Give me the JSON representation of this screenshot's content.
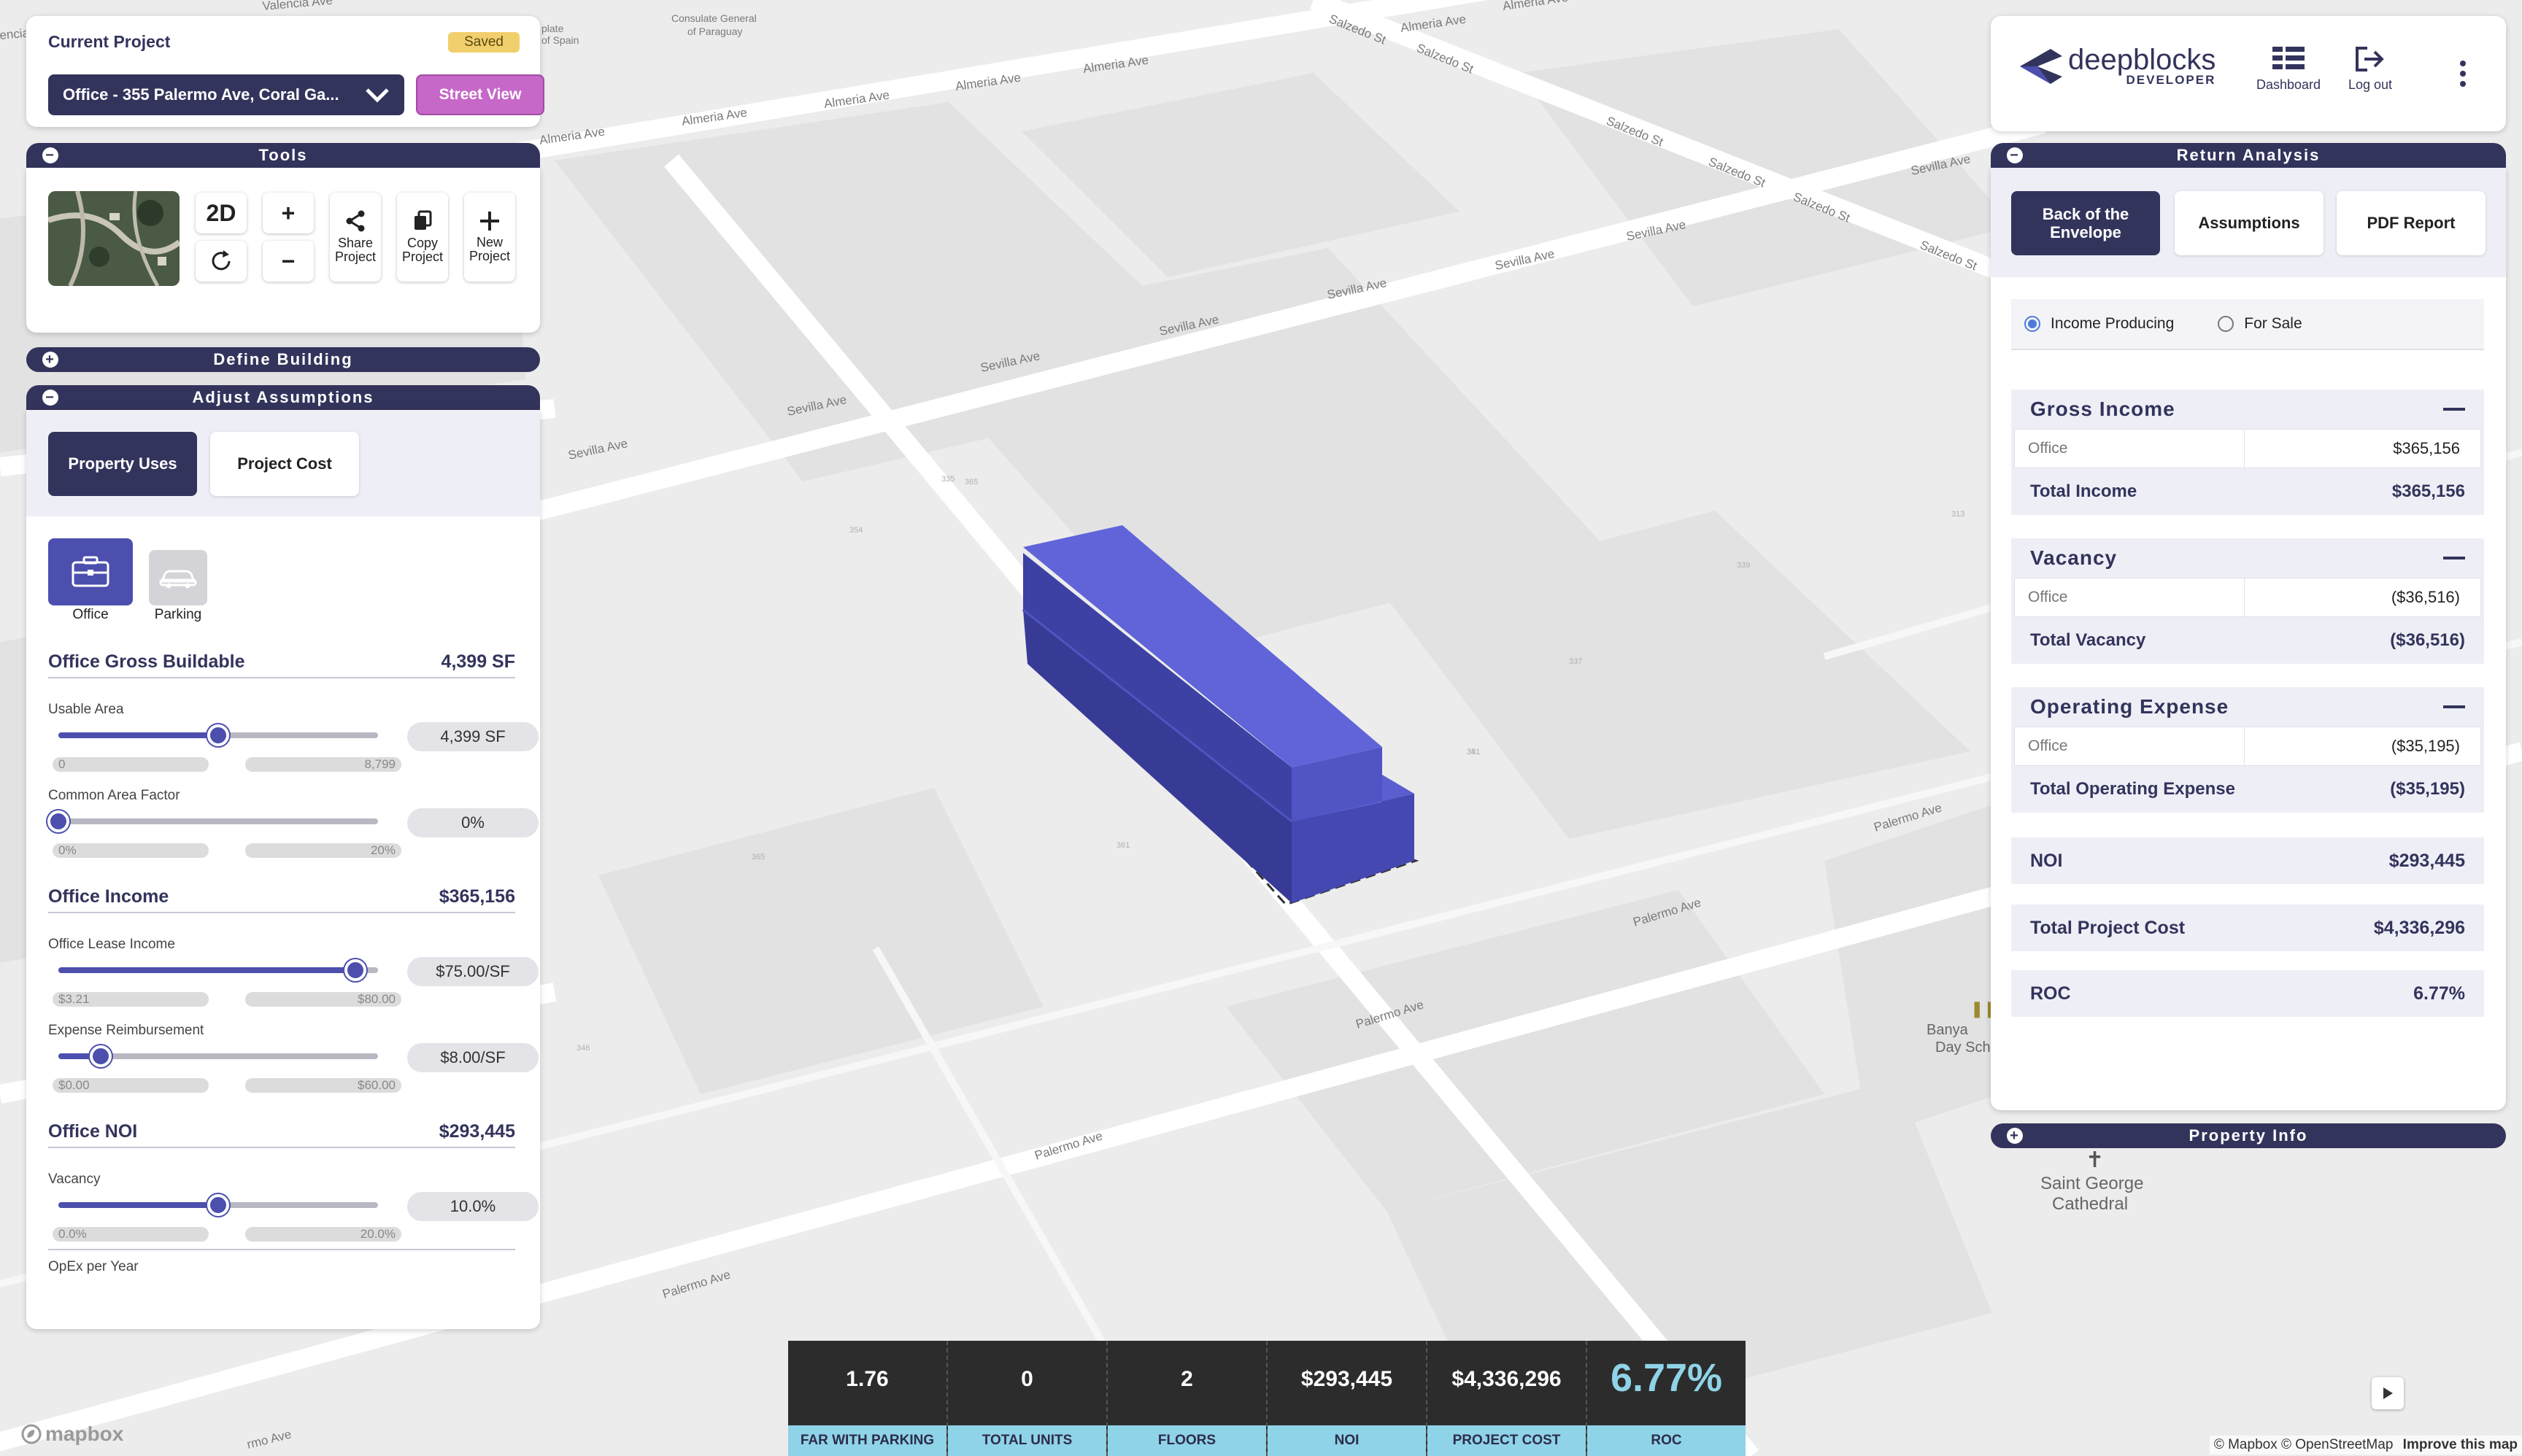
{
  "project": {
    "title": "Current Project",
    "status": "Saved",
    "selected": "Office - 355 Palermo Ave, Coral Ga...",
    "street_view": "Street View"
  },
  "tools": {
    "title": "Tools",
    "mode": "2D",
    "zoom_in": "+",
    "zoom_out": "−",
    "share": "Share Project",
    "copy": "Copy Project",
    "new": "New Project"
  },
  "define_building": {
    "title": "Define Building"
  },
  "assumptions": {
    "title": "Adjust Assumptions",
    "tabs": [
      "Property Uses",
      "Project Cost"
    ],
    "uses": [
      {
        "label": "Office",
        "icon": "briefcase-icon",
        "active": true
      },
      {
        "label": "Parking",
        "icon": "car-icon",
        "active": false
      }
    ],
    "sections": [
      {
        "title": "Office Gross Buildable",
        "value": "4,399 SF",
        "sliders": [
          {
            "label": "Usable Area",
            "min": "0",
            "max": "8,799",
            "value": "4,399 SF",
            "pct": 0.5
          },
          {
            "label": "Common Area Factor",
            "min": "0%",
            "max": "20%",
            "value": "0%",
            "pct": 0.0
          }
        ]
      },
      {
        "title": "Office Income",
        "value": "$365,156",
        "sliders": [
          {
            "label": "Office Lease Income",
            "min": "$3.21",
            "max": "$80.00",
            "value": "$75.00/SF",
            "pct": 0.93
          },
          {
            "label": "Expense Reimbursement",
            "min": "$0.00",
            "max": "$60.00",
            "value": "$8.00/SF",
            "pct": 0.133
          }
        ]
      },
      {
        "title": "Office NOI",
        "value": "$293,445",
        "sliders": [
          {
            "label": "Vacancy",
            "min": "0.0%",
            "max": "20.0%",
            "value": "10.0%",
            "pct": 0.5
          },
          {
            "label": "OpEx per Year"
          }
        ]
      }
    ]
  },
  "header": {
    "logo_word": "deepblocks",
    "logo_sub": "DEVELOPER",
    "dashboard": "Dashboard",
    "logout": "Log out"
  },
  "return_analysis": {
    "title": "Return Analysis",
    "tabs": [
      "Back of the Envelope",
      "Assumptions",
      "PDF Report"
    ],
    "radio": [
      "Income Producing",
      "For Sale"
    ],
    "gross_income": {
      "title": "Gross Income",
      "line_label": "Office",
      "line_value": "$365,156",
      "total_label": "Total Income",
      "total_value": "$365,156"
    },
    "vacancy": {
      "title": "Vacancy",
      "line_label": "Office",
      "line_value": "($36,516)",
      "total_label": "Total Vacancy",
      "total_value": "($36,516)"
    },
    "opex": {
      "title": "Operating Expense",
      "line_label": "Office",
      "line_value": "($35,195)",
      "total_label": "Total Operating Expense",
      "total_value": "($35,195)"
    },
    "noi": {
      "label": "NOI",
      "value": "$293,445"
    },
    "project_cost": {
      "label": "Total Project Cost",
      "value": "$4,336,296"
    },
    "roc": {
      "label": "ROC",
      "value": "6.77%"
    }
  },
  "property_info": {
    "title": "Property Info"
  },
  "stats": [
    {
      "value": "1.76",
      "label": "FAR WITH PARKING"
    },
    {
      "value": "0",
      "label": "TOTAL UNITS"
    },
    {
      "value": "2",
      "label": "FLOORS"
    },
    {
      "value": "$293,445",
      "label": "NOI"
    },
    {
      "value": "$4,336,296",
      "label": "PROJECT COST"
    },
    {
      "value": "6.77%",
      "label": "ROC"
    }
  ],
  "map": {
    "streets": {
      "palermo": "Palermo Ave",
      "sevilla": "Sevilla Ave",
      "almeria": "Almeria Ave",
      "salzedo": "Salzedo St",
      "valencia": "Valencia Ave",
      "encia": "encia",
      "rmo": "rmo Ave"
    },
    "pois": {
      "consulate_paraguay_1": "Consulate General",
      "consulate_paraguay_2": "of Paraguay",
      "consulate_spain_1": "plate",
      "consulate_spain_2": "of Spain",
      "banyan_1": "Banya",
      "banyan_2": "Day Sch",
      "cathedral_1": "Saint George",
      "cathedral_2": "Cathedral"
    },
    "lot_numbers": [
      "365",
      "361",
      "335",
      "337",
      "339",
      "313",
      "351",
      "354",
      "341",
      "346",
      "365"
    ],
    "mapbox": "mapbox",
    "attribution": "© Mapbox © OpenStreetMap",
    "improve": "Improve this map"
  },
  "colors": {
    "navy": "#33345c",
    "building": "#4e52c8",
    "accent_purple": "#c668c8",
    "stat_cyan": "#8fd3e8"
  }
}
